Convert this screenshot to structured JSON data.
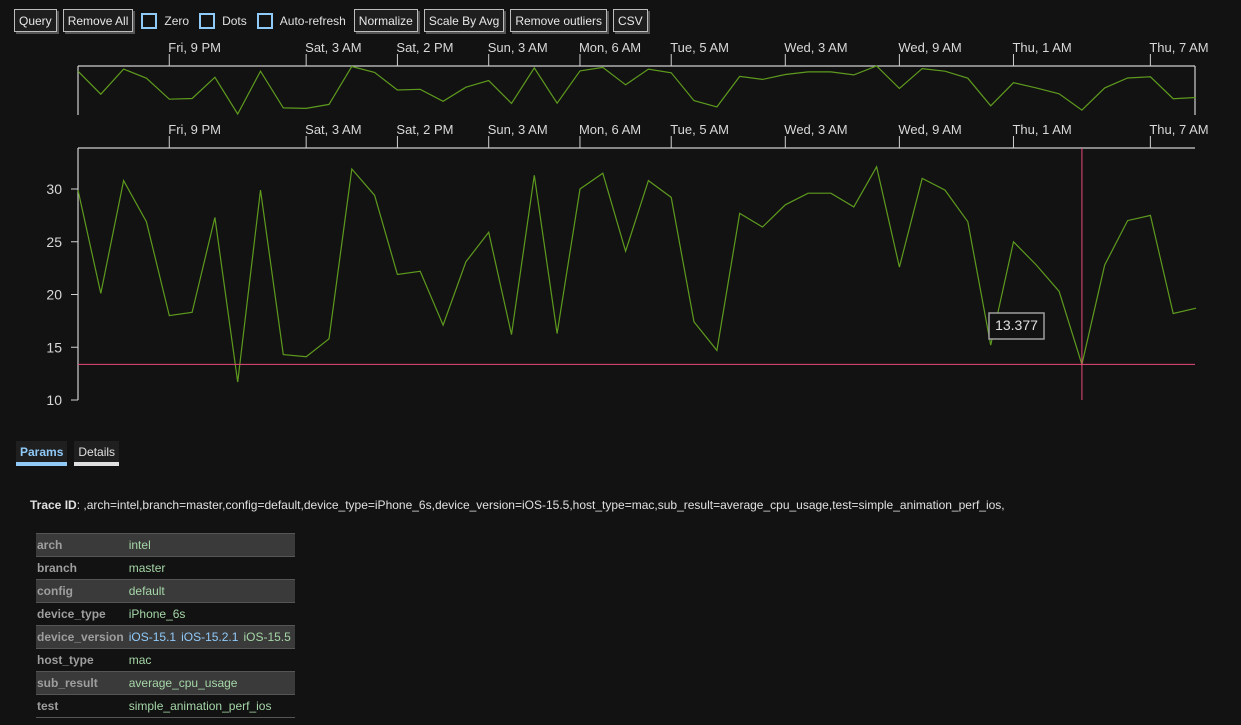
{
  "toolbar": {
    "query": "Query",
    "remove_all": "Remove All",
    "zero": "Zero",
    "dots": "Dots",
    "auto_refresh": "Auto-refresh",
    "normalize": "Normalize",
    "scale_by_avg": "Scale By Avg",
    "remove_outliers": "Remove outliers",
    "csv": "CSV"
  },
  "colors": {
    "trace": "#5e9a1e",
    "crosshair": "#e84a7a",
    "axis": "#d0d0d0",
    "checkbox": "#90caf9",
    "value_green": "#a5d6a7",
    "value_blue": "#90caf9"
  },
  "chart_data": {
    "type": "line",
    "title": "",
    "xlabel": "",
    "ylabel": "",
    "ylim": [
      10,
      34
    ],
    "yticks": [
      10,
      15,
      20,
      25,
      30
    ],
    "x_tick_labels": [
      {
        "index": 4,
        "label": "Fri, 9 PM"
      },
      {
        "index": 10,
        "label": "Sat, 3 AM"
      },
      {
        "index": 14,
        "label": "Sat, 2 PM"
      },
      {
        "index": 18,
        "label": "Sun, 3 AM"
      },
      {
        "index": 22,
        "label": "Mon, 6 AM"
      },
      {
        "index": 26,
        "label": "Tue, 5 AM"
      },
      {
        "index": 31,
        "label": "Wed, 3 AM"
      },
      {
        "index": 36,
        "label": "Wed, 9 AM"
      },
      {
        "index": 41,
        "label": "Thu, 1 AM"
      },
      {
        "index": 47,
        "label": "Thu, 7 AM"
      }
    ],
    "series": [
      {
        "name": ",arch=intel,branch=master,config=default,device_type=iPhone_6s,device_version=iOS-15.5,host_type=mac,sub_result=average_cpu_usage,test=simple_animation_perf_ios,",
        "values": [
          29.9,
          20.1,
          30.8,
          26.9,
          18.0,
          18.3,
          27.3,
          11.7,
          29.9,
          14.3,
          14.1,
          15.8,
          31.9,
          29.4,
          21.9,
          22.2,
          17.1,
          23.1,
          25.9,
          16.2,
          31.3,
          16.3,
          30.0,
          31.5,
          24.1,
          30.8,
          29.2,
          17.4,
          14.7,
          27.7,
          26.4,
          28.5,
          29.6,
          29.6,
          28.3,
          32.1,
          22.6,
          31.0,
          29.9,
          26.9,
          15.2,
          25.0,
          22.8,
          20.3,
          13.377,
          22.8,
          27.0,
          27.5,
          18.2,
          18.7
        ]
      }
    ],
    "crosshair": {
      "index": 44,
      "value": 13.377,
      "label": "13.377"
    },
    "grid": false,
    "legend": "none"
  },
  "tabs": [
    {
      "label": "Params",
      "active": true
    },
    {
      "label": "Details",
      "active": false
    }
  ],
  "trace_id": {
    "label": "Trace ID",
    "value": ": ,arch=intel,branch=master,config=default,device_type=iPhone_6s,device_version=iOS-15.5,host_type=mac,sub_result=average_cpu_usage,test=simple_animation_perf_ios,"
  },
  "params": [
    {
      "key": "arch",
      "values": [
        {
          "v": "intel",
          "selected": true
        }
      ]
    },
    {
      "key": "branch",
      "values": [
        {
          "v": "master",
          "selected": true
        }
      ]
    },
    {
      "key": "config",
      "values": [
        {
          "v": "default",
          "selected": true
        }
      ]
    },
    {
      "key": "device_type",
      "values": [
        {
          "v": "iPhone_6s",
          "selected": true
        }
      ]
    },
    {
      "key": "device_version",
      "values": [
        {
          "v": "iOS-15.1",
          "selected": false
        },
        {
          "v": "iOS-15.2.1",
          "selected": false
        },
        {
          "v": "iOS-15.5",
          "selected": true
        }
      ]
    },
    {
      "key": "host_type",
      "values": [
        {
          "v": "mac",
          "selected": true
        }
      ]
    },
    {
      "key": "sub_result",
      "values": [
        {
          "v": "average_cpu_usage",
          "selected": true
        }
      ]
    },
    {
      "key": "test",
      "values": [
        {
          "v": "simple_animation_perf_ios",
          "selected": true
        }
      ]
    }
  ]
}
